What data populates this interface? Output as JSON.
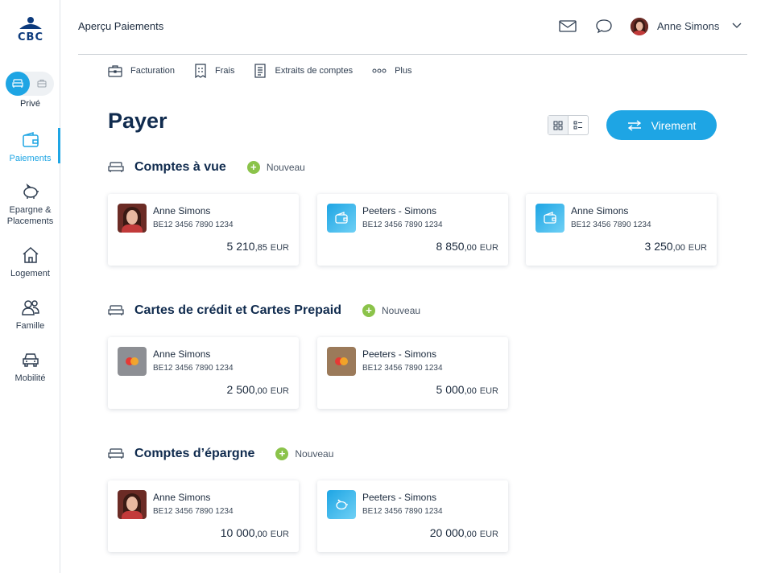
{
  "sidebar": {
    "logo": "CBC",
    "profile_label": "Privé",
    "items": [
      {
        "label": "Paiements",
        "icon": "wallet-icon"
      },
      {
        "label": "Epargne & Placements",
        "icon": "piggy-bank-icon"
      },
      {
        "label": "Logement",
        "icon": "house-icon"
      },
      {
        "label": "Famille",
        "icon": "family-icon"
      },
      {
        "label": "Mobilité",
        "icon": "car-icon"
      }
    ]
  },
  "header": {
    "title": "Aperçu Paiements",
    "user_name": "Anne Simons"
  },
  "subnav": {
    "items": [
      {
        "label": "Facturation",
        "icon": "briefcase-icon"
      },
      {
        "label": "Frais",
        "icon": "receipt-icon"
      },
      {
        "label": "Extraits de comptes",
        "icon": "statement-icon"
      },
      {
        "label": "Plus",
        "icon": "more-icon"
      }
    ]
  },
  "main": {
    "title": "Payer",
    "transfer_button": "Virement",
    "new_label": "Nouveau",
    "sections": [
      {
        "title": "Comptes à vue",
        "cards": [
          {
            "owner": "Anne Simons",
            "iban": "BE12 3456 7890 1234",
            "amount_int": "5 210",
            "amount_dec": ",85",
            "currency": "EUR"
          },
          {
            "owner": "Peeters - Simons",
            "iban": "BE12 3456 7890 1234",
            "amount_int": "8 850",
            "amount_dec": ",00",
            "currency": "EUR"
          },
          {
            "owner": "Anne Simons",
            "iban": "BE12 3456 7890 1234",
            "amount_int": "3 250",
            "amount_dec": ",00",
            "currency": "EUR"
          }
        ]
      },
      {
        "title": "Cartes de crédit et Cartes Prepaid",
        "cards": [
          {
            "owner": "Anne Simons",
            "iban": "BE12 3456 7890 1234",
            "amount_int": "2 500",
            "amount_dec": ",00",
            "currency": "EUR"
          },
          {
            "owner": "Peeters - Simons",
            "iban": "BE12 3456 7890 1234",
            "amount_int": "5 000",
            "amount_dec": ",00",
            "currency": "EUR"
          }
        ]
      },
      {
        "title": "Comptes d’épargne",
        "cards": [
          {
            "owner": "Anne Simons",
            "iban": "BE12 3456 7890 1234",
            "amount_int": "10 000",
            "amount_dec": ",00",
            "currency": "EUR"
          },
          {
            "owner": "Peeters - Simons",
            "iban": "BE12 3456 7890 1234",
            "amount_int": "20 000",
            "amount_dec": ",00",
            "currency": "EUR"
          }
        ]
      }
    ]
  },
  "colors": {
    "accent": "#1ea5e4",
    "navy": "#102b4e",
    "green": "#8bc34a"
  }
}
